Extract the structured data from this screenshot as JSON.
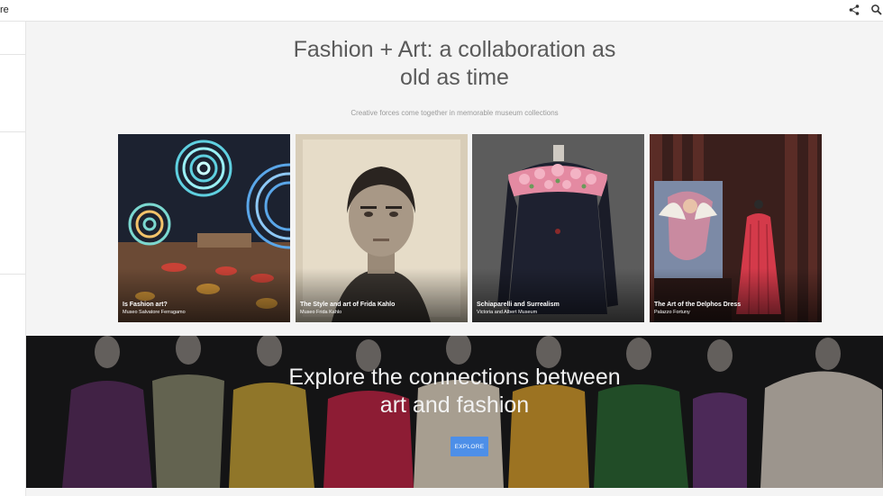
{
  "app": {
    "brand_fragment": "re"
  },
  "header": {
    "title_line1": "Fashion + Art: a collaboration as",
    "title_line2": "old as time",
    "subtitle": "Creative forces come together in memorable museum collections"
  },
  "cards": [
    {
      "title": "Is Fashion art?",
      "source": "Museo Salvatore Ferragamo"
    },
    {
      "title": "The Style and art of Frida Kahlo",
      "source": "Museo Frida Kahlo"
    },
    {
      "title": "Schiaparelli and Surrealism",
      "source": "Victoria and Albert Museum"
    },
    {
      "title": "The Art of the Delphos Dress",
      "source": "Palazzo Fortuny"
    }
  ],
  "banner": {
    "title_line1": "Explore the connections between",
    "title_line2": "art and fashion",
    "button_label": "EXPLORE"
  },
  "colors": {
    "accent": "#4d8fe8",
    "background": "#f4f4f4"
  },
  "icons": [
    "share-icon",
    "search-icon"
  ]
}
